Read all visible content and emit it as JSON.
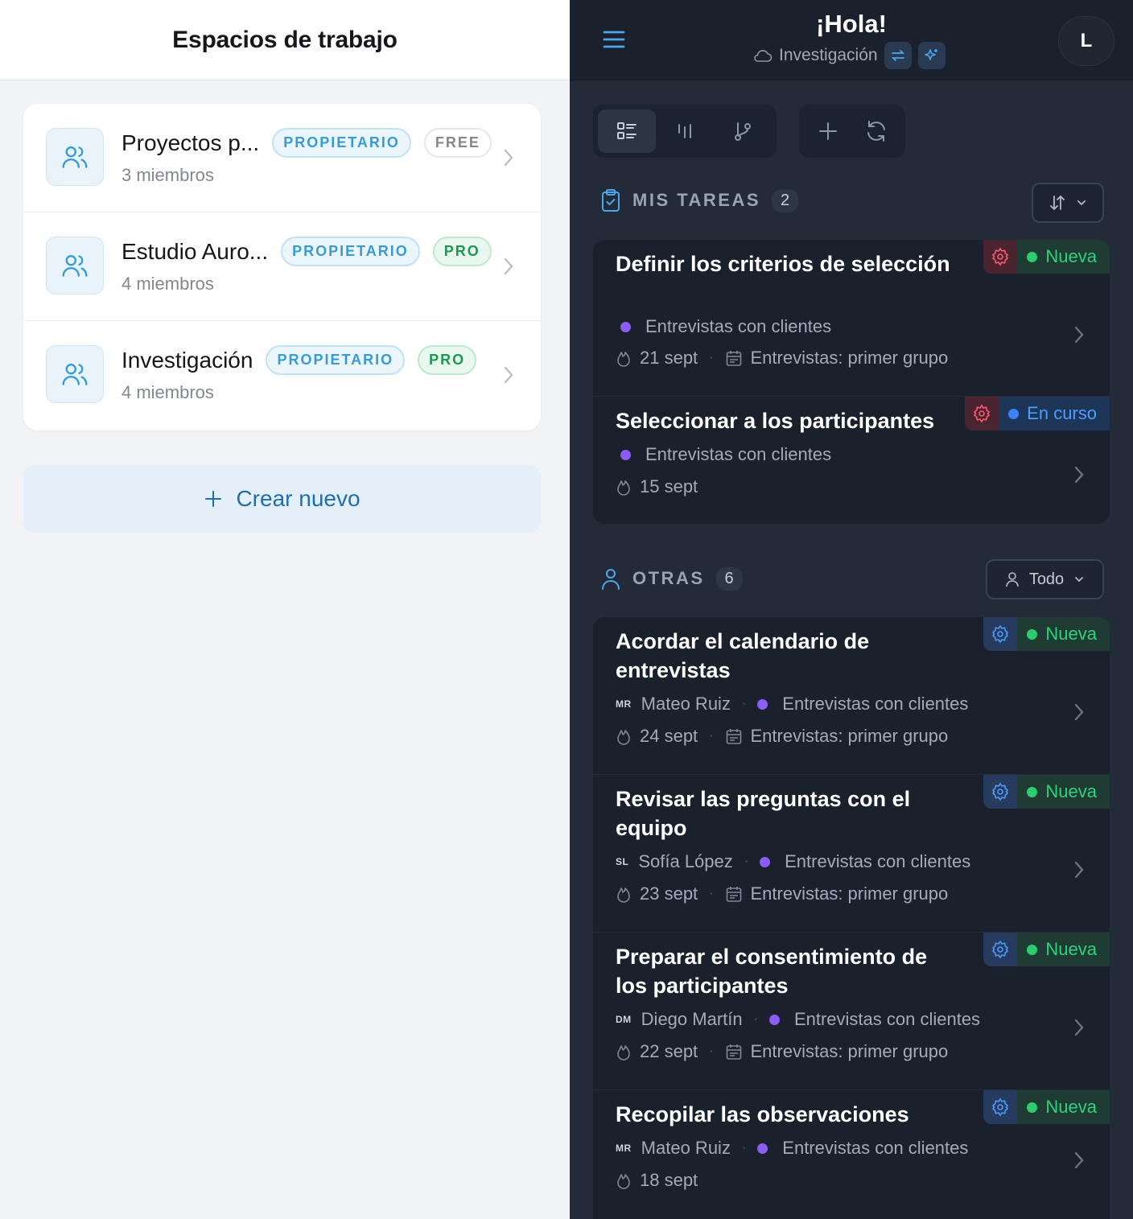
{
  "workspaces_panel": {
    "title": "Espacios de trabajo",
    "items": [
      {
        "name": "Proyectos p...",
        "role": "PROPIETARIO",
        "plan": "FREE",
        "members": "3 miembros"
      },
      {
        "name": "Estudio Auro...",
        "role": "PROPIETARIO",
        "plan": "PRO",
        "members": "4 miembros"
      },
      {
        "name": "Investigación",
        "role": "PROPIETARIO",
        "plan": "PRO",
        "members": "4 miembros"
      }
    ],
    "create_label": "Crear nuevo"
  },
  "header": {
    "greeting": "¡Hola!",
    "workspace": "Investigación",
    "avatar_initial": "L"
  },
  "sections": {
    "mine": {
      "title": "MIS TAREAS",
      "count": "2"
    },
    "others": {
      "title": "OTRAS",
      "count": "6",
      "filter_label": "Todo"
    }
  },
  "my_tasks": [
    {
      "title": "Definir los criterios de selección",
      "status": "Nueva",
      "project": "Entrevistas con clientes",
      "date": "21 sept",
      "milestone": "Entrevistas: primer grupo"
    },
    {
      "title": "Seleccionar a los participantes",
      "status": "En curso",
      "project": "Entrevistas con clientes",
      "date": "15 sept"
    }
  ],
  "other_tasks": [
    {
      "title": "Acordar el calendario de entrevistas",
      "status": "Nueva",
      "initials": "MR",
      "assignee": "Mateo Ruiz",
      "project": "Entrevistas con clientes",
      "date": "24 sept",
      "milestone": "Entrevistas: primer grupo"
    },
    {
      "title": "Revisar las preguntas con el equipo",
      "status": "Nueva",
      "initials": "SL",
      "assignee": "Sofía López",
      "project": "Entrevistas con clientes",
      "date": "23 sept",
      "milestone": "Entrevistas: primer grupo"
    },
    {
      "title": "Preparar el consentimiento de los participantes",
      "status": "Nueva",
      "initials": "DM",
      "assignee": "Diego Martín",
      "project": "Entrevistas con clientes",
      "date": "22 sept",
      "milestone": "Entrevistas: primer grupo"
    },
    {
      "title": "Recopilar las observaciones",
      "status": "Nueva",
      "initials": "MR",
      "assignee": "Mateo Ruiz",
      "project": "Entrevistas con clientes",
      "date": "18 sept"
    }
  ],
  "colors": {
    "accent": "#3a9bd1",
    "status_new": "#2fd17a",
    "status_in_progress": "#4f9bff",
    "project_dot": "#8b5cf6",
    "dark_bg": "#232b39"
  }
}
